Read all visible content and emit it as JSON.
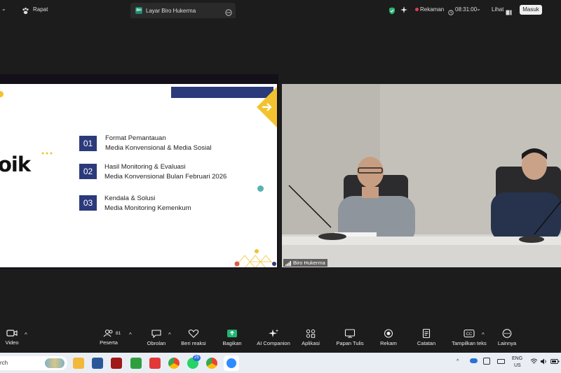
{
  "topbar": {
    "meeting_label": "Rapat",
    "share_tab_badge": "BH",
    "share_tab_label": "Layar Biro Hukerma",
    "recording_label": "Rekaman",
    "timer": "08:31:00",
    "view_label": "Lihat",
    "signin_label": "Masuk"
  },
  "slide": {
    "title_fragment": "oik",
    "items": [
      {
        "num": "01",
        "line1": "Format Pemantauan",
        "line2": "Media Konvensional & Media Sosial"
      },
      {
        "num": "02",
        "line1": "Hasil Monitoring & Evaluasi",
        "line2": "Media Konvensional Bulan Februari 2026"
      },
      {
        "num": "03",
        "line1": "Kendala & Solusi",
        "line2": "Media Monitoring Kemenkum"
      }
    ],
    "colors": {
      "navy": "#2b3a7a",
      "yellow": "#f2c230"
    }
  },
  "video": {
    "participant_label": "Biro Hukerma"
  },
  "toolbar": {
    "video_label": "Video",
    "participants_label": "Peserta",
    "participants_count": "81",
    "chat_label": "Obrolan",
    "react_label": "Beri reaksi",
    "share_label": "Bagikan",
    "ai_label": "AI Companion",
    "apps_label": "Aplikasi",
    "whiteboard_label": "Papan Tulis",
    "record_label": "Rekam",
    "notes_label": "Catatan",
    "captions_label": "Tampilkan teks",
    "more_label": "Lainnya"
  },
  "taskbar": {
    "search_text": "rch",
    "whatsapp_badge": "25",
    "lang_top": "ENG",
    "lang_bottom": "US"
  }
}
